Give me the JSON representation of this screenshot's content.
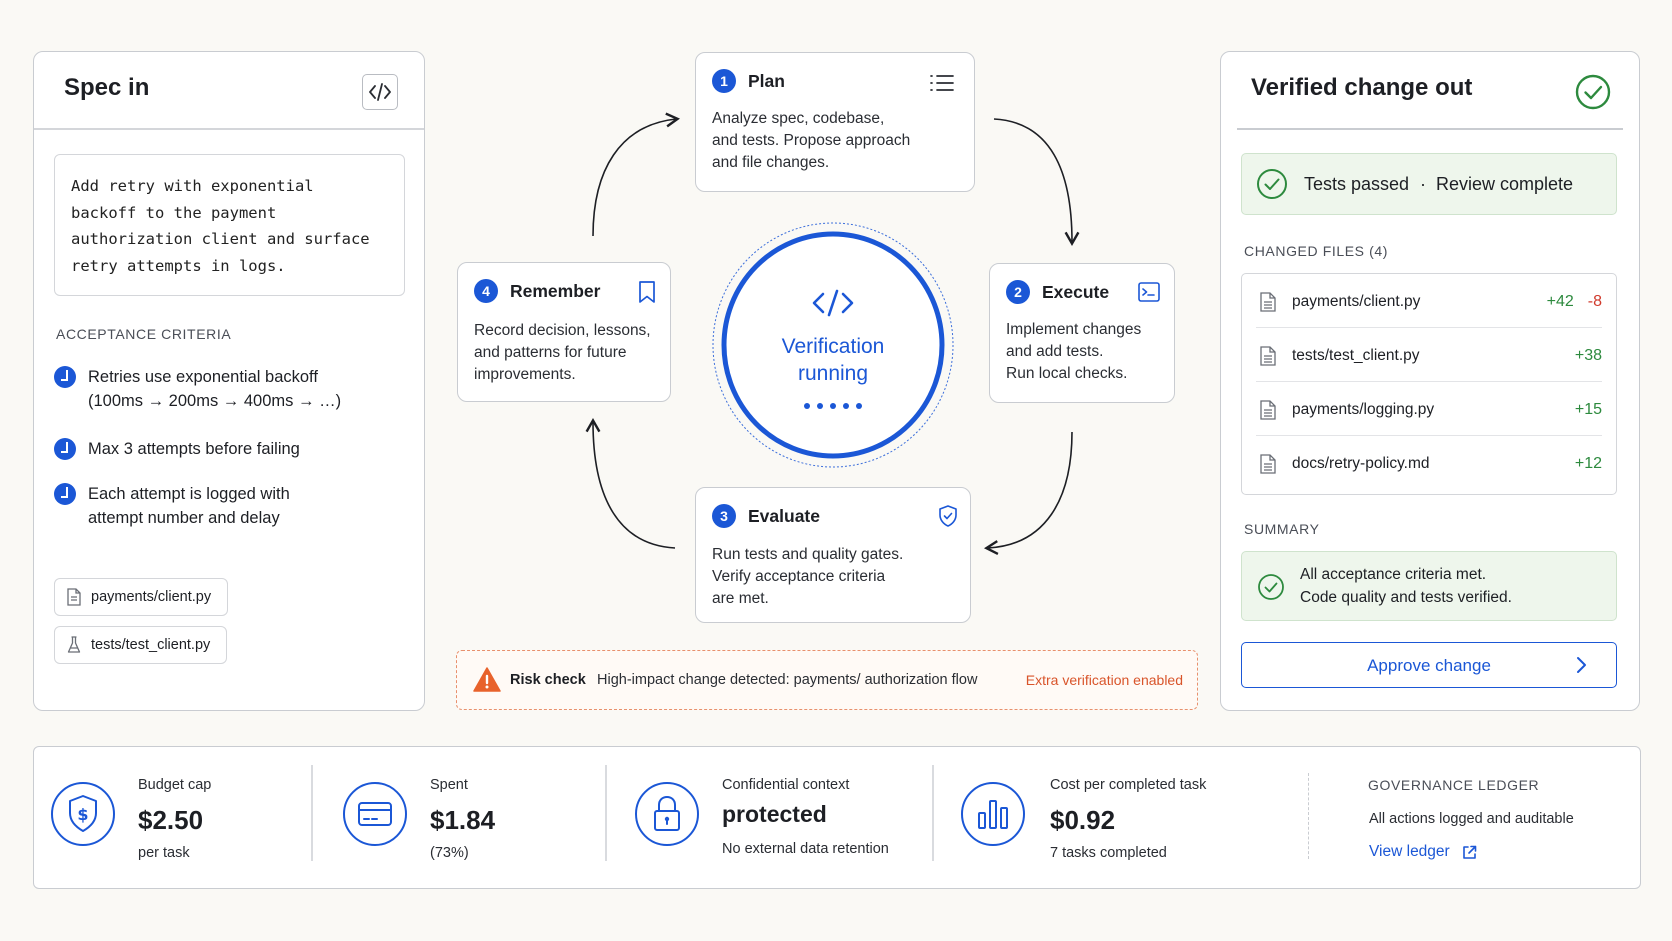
{
  "spec": {
    "title": "Spec in",
    "code_text": "Add retry with exponential backoff to the payment authorization client and surface retry attempts in logs.",
    "criteria_heading": "ACCEPTANCE CRITERIA",
    "criteria": [
      {
        "line1": "Retries use exponential backoff",
        "line2": "(100ms → 200ms → 400ms → …)"
      },
      {
        "line1": "Max 3 attempts before failing",
        "line2": ""
      },
      {
        "line1": "Each attempt is logged with",
        "line2": "attempt number and delay"
      }
    ],
    "files": [
      "payments/client.py",
      "tests/test_client.py"
    ]
  },
  "steps": {
    "plan": {
      "num": "1",
      "title": "Plan",
      "lines": [
        "Analyze spec, codebase,",
        "and tests. Propose approach",
        "and file changes."
      ]
    },
    "execute": {
      "num": "2",
      "title": "Execute",
      "lines": [
        "Implement changes",
        "and add tests.",
        "Run local checks."
      ]
    },
    "evaluate": {
      "num": "3",
      "title": "Evaluate",
      "lines": [
        "Run tests and quality gates.",
        "Verify acceptance criteria",
        "are met."
      ]
    },
    "remember": {
      "num": "4",
      "title": "Remember",
      "lines": [
        "Record decision, lessons,",
        "and patterns for future",
        "improvements."
      ]
    }
  },
  "center": {
    "line1": "Verification",
    "line2": "running"
  },
  "risk": {
    "label": "Risk check",
    "message": "High-impact change detected: payments/ authorization flow",
    "status": "Extra verification enabled"
  },
  "verified": {
    "title": "Verified change out",
    "status_a": "Tests passed",
    "status_sep": "·",
    "status_b": "Review complete",
    "files_heading": "CHANGED FILES (4)",
    "files": [
      {
        "name": "payments/client.py",
        "added": "+42",
        "removed": "-8"
      },
      {
        "name": "tests/test_client.py",
        "added": "+38",
        "removed": ""
      },
      {
        "name": "payments/logging.py",
        "added": "+15",
        "removed": ""
      },
      {
        "name": "docs/retry-policy.md",
        "added": "+12",
        "removed": ""
      }
    ],
    "summary_heading": "SUMMARY",
    "summary_line1": "All acceptance criteria met.",
    "summary_line2": "Code quality and tests verified.",
    "approve_label": "Approve change"
  },
  "metrics": {
    "budget": {
      "label": "Budget cap",
      "value": "$2.50",
      "sub": "per task"
    },
    "spent": {
      "label": "Spent",
      "value": "$1.84",
      "sub": "(73%)"
    },
    "confidential": {
      "label": "Confidential context",
      "value": "protected",
      "sub": "No external data retention"
    },
    "cost": {
      "label": "Cost per completed task",
      "value": "$0.92",
      "sub": "7 tasks completed"
    },
    "ledger": {
      "heading": "GOVERNANCE LEDGER",
      "text": "All actions logged and auditable",
      "link": "View ledger"
    }
  },
  "colors": {
    "accent": "#1b57d6",
    "success": "#2d8a3e",
    "danger": "#d03a2c",
    "warning": "#e8622c"
  }
}
